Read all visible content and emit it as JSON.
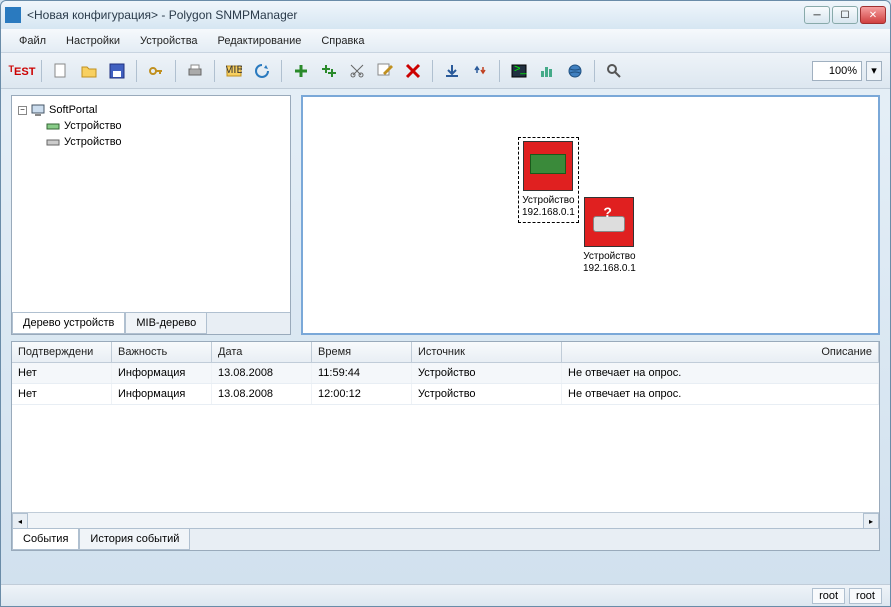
{
  "window": {
    "title": "<Новая конфигурация> - Polygon SNMPManager"
  },
  "menu": {
    "file": "Файл",
    "settings": "Настройки",
    "devices": "Устройства",
    "edit": "Редактирование",
    "help": "Справка"
  },
  "toolbar": {
    "zoom_value": "100%"
  },
  "tree": {
    "root": "SoftPortal",
    "child1": "Устройство",
    "child2": "Устройство",
    "tab_devices": "Дерево устройств",
    "tab_mib": "MIB-дерево"
  },
  "canvas": {
    "dev1_name": "Устройство",
    "dev1_ip": "192.168.0.1",
    "dev2_name": "Устройство",
    "dev2_ip": "192.168.0.1"
  },
  "grid": {
    "headers": {
      "confirmed": "Подтверждени",
      "severity": "Важность",
      "date": "Дата",
      "time": "Время",
      "source": "Источник",
      "description": "Описание"
    },
    "rows": [
      {
        "confirmed": "Нет",
        "severity": "Информация",
        "date": "13.08.2008",
        "time": "11:59:44",
        "source": "Устройство",
        "description": "Не отвечает на опрос."
      },
      {
        "confirmed": "Нет",
        "severity": "Информация",
        "date": "13.08.2008",
        "time": "12:00:12",
        "source": "Устройство",
        "description": "Не отвечает на опрос."
      }
    ],
    "tab_events": "События",
    "tab_history": "История событий"
  },
  "status": {
    "cell1": "root",
    "cell2": "root"
  }
}
